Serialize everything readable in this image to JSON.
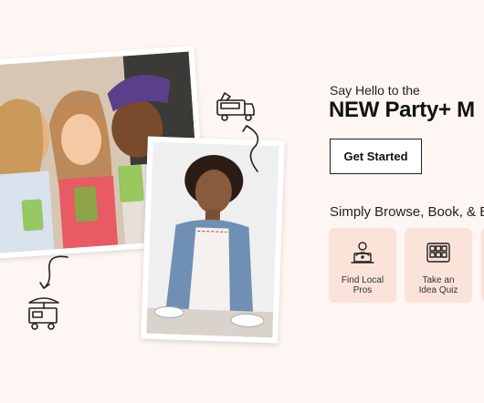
{
  "hero": {
    "eyebrow": "Say Hello to the",
    "headline": "NEW Party+ M",
    "cta_label": "Get Started",
    "subhead": "Simply Browse, Book, & E",
    "cards": [
      {
        "label": "Find Local\nPros",
        "icon": "person-laptop-icon"
      },
      {
        "label": "Take an\nIdea Quiz",
        "icon": "quiz-grid-icon"
      }
    ]
  },
  "colors": {
    "background": "#fdf6f2",
    "card": "#fbe3da",
    "text": "#111111"
  }
}
